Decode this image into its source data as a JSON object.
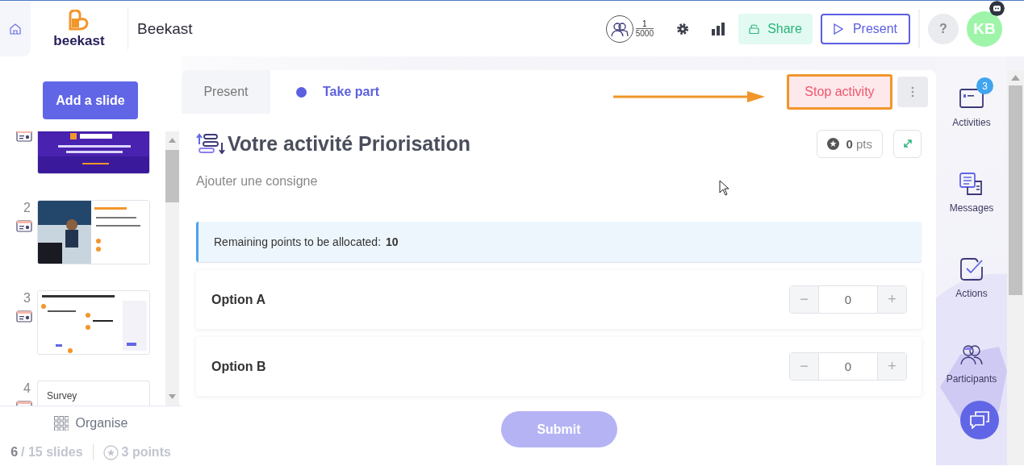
{
  "header": {
    "logo": "beekast",
    "title": "Beekast",
    "participants": {
      "count": "1",
      "limit": "5000"
    },
    "share_button": "Share",
    "present_button": "Present",
    "help_button": "?",
    "avatar": "KB"
  },
  "sidebar": {
    "add_button": "Add a slide",
    "slides": [
      {
        "kind": "picture"
      },
      {
        "number": "2",
        "kind": "picture"
      },
      {
        "number": "3",
        "kind": "picture"
      },
      {
        "number": "4",
        "kind": "text",
        "title": "Survey"
      }
    ],
    "organise_button": "Organise",
    "slide_count": "6",
    "slide_total": "/ 15 slides",
    "points": "3 points"
  },
  "activity": {
    "tabs": [
      {
        "label": "Present",
        "selected": false
      },
      {
        "label": "Take part",
        "selected": true
      }
    ],
    "stop_button": "Stop activity",
    "title": "Votre activité Priorisation",
    "score": "**0** pts",
    "instruction": {
      "placeholder": "Ajouter une consigne"
    },
    "remaining": {
      "label": "Remaining points to be allocated:",
      "value": "10"
    },
    "options": [
      {
        "label": "Option A",
        "value": "0",
        "decrement": "−",
        "increment": "+"
      },
      {
        "label": "Option B",
        "value": "0",
        "decrement": "−",
        "increment": "+"
      }
    ],
    "submit": {
      "label": "Submit",
      "disabled": true
    }
  },
  "rail": [
    {
      "kind": "activities",
      "label": "Activities",
      "badge": "3"
    },
    {
      "kind": "messages",
      "label": "Messages"
    },
    {
      "kind": "actions",
      "label": "Actions"
    },
    {
      "kind": "participants",
      "label": "Participants"
    }
  ]
}
